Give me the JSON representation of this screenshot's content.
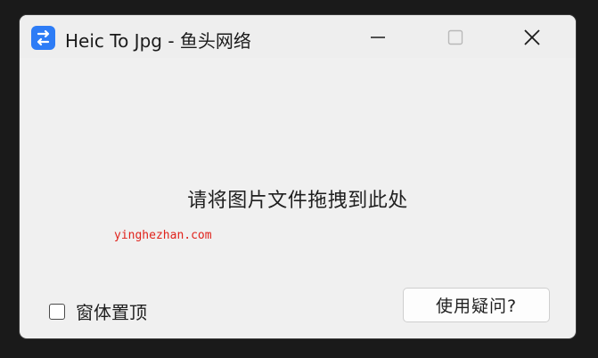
{
  "window": {
    "title": "Heic To Jpg - 鱼头网络"
  },
  "titlebar_buttons": {
    "minimize_icon": "minimize-icon",
    "maximize_icon": "maximize-icon",
    "close_icon": "close-icon"
  },
  "main": {
    "drop_hint": "请将图片文件拖拽到此处",
    "watermark": "yinghezhan.com"
  },
  "footer": {
    "pin_checkbox_label": "窗体置顶",
    "pin_checked": false,
    "help_button_label": "使用疑问?"
  },
  "colors": {
    "accent": "#2d7cf6",
    "watermark": "#e0221b",
    "window_bg": "#f0f0f0"
  }
}
